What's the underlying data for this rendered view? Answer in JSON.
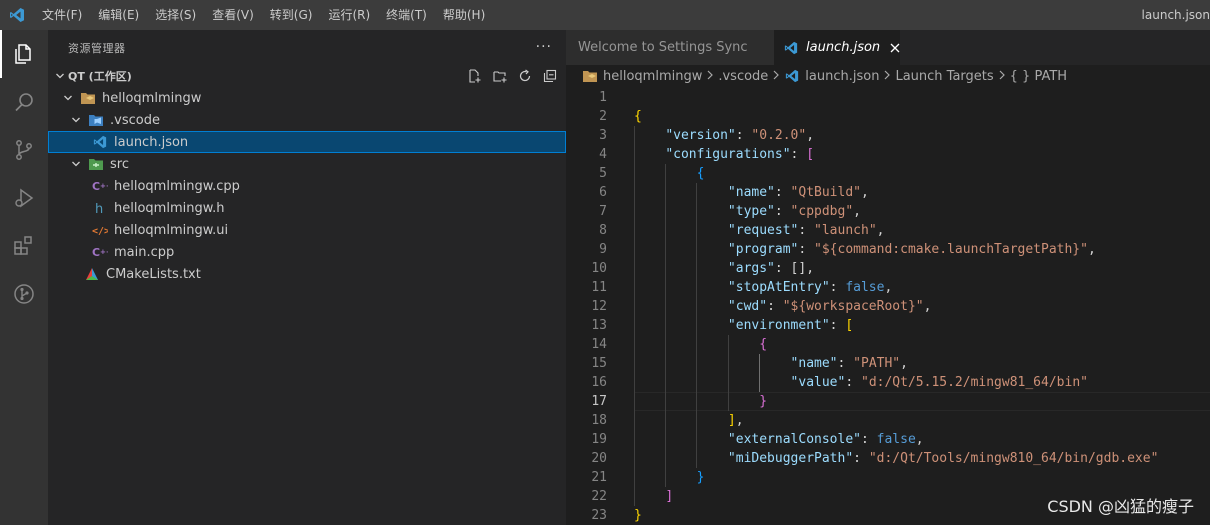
{
  "titlebar": {
    "menu": [
      "文件(F)",
      "编辑(E)",
      "选择(S)",
      "查看(V)",
      "转到(G)",
      "运行(R)",
      "终端(T)",
      "帮助(H)"
    ],
    "window_title": "launch.json"
  },
  "activitybar": {
    "items": [
      "explorer-icon",
      "search-icon",
      "source-control-icon",
      "run-debug-icon",
      "extensions-icon",
      "git-graph-icon"
    ]
  },
  "sidebar": {
    "title": "资源管理器",
    "more": "···",
    "workspace": "QT (工作区)",
    "tree": [
      {
        "label": "helloqmlmingw",
        "type": "folder",
        "indent": 1
      },
      {
        "label": ".vscode",
        "type": "vscode-folder",
        "indent": 2
      },
      {
        "label": "launch.json",
        "type": "json",
        "indent": 3,
        "selected": true
      },
      {
        "label": "src",
        "type": "src-folder",
        "indent": 2
      },
      {
        "label": "helloqmlmingw.cpp",
        "type": "cpp",
        "indent": 3
      },
      {
        "label": "helloqmlmingw.h",
        "type": "h",
        "indent": 3
      },
      {
        "label": "helloqmlmingw.ui",
        "type": "ui",
        "indent": 3
      },
      {
        "label": "main.cpp",
        "type": "cpp",
        "indent": 3
      },
      {
        "label": "CMakeLists.txt",
        "type": "cmake",
        "indent": 2
      }
    ]
  },
  "editor": {
    "tabs": [
      {
        "label": "Welcome to Settings Sync",
        "active": false
      },
      {
        "label": "launch.json",
        "active": true
      }
    ],
    "breadcrumbs": [
      "helloqmlmingw",
      ".vscode",
      "launch.json",
      "Launch Targets",
      "{ } PATH"
    ],
    "current_line": 17,
    "lines": [
      [],
      [
        [
          "br1",
          "{"
        ]
      ],
      [
        [
          "p",
          "    "
        ],
        [
          "k",
          "\"version\""
        ],
        [
          "p",
          ": "
        ],
        [
          "s",
          "\"0.2.0\""
        ],
        [
          "p",
          ","
        ]
      ],
      [
        [
          "p",
          "    "
        ],
        [
          "k",
          "\"configurations\""
        ],
        [
          "p",
          ": "
        ],
        [
          "br2",
          "["
        ]
      ],
      [
        [
          "p",
          "        "
        ],
        [
          "br3",
          "{"
        ]
      ],
      [
        [
          "p",
          "            "
        ],
        [
          "k",
          "\"name\""
        ],
        [
          "p",
          ": "
        ],
        [
          "s",
          "\"QtBuild\""
        ],
        [
          "p",
          ","
        ]
      ],
      [
        [
          "p",
          "            "
        ],
        [
          "k",
          "\"type\""
        ],
        [
          "p",
          ": "
        ],
        [
          "s",
          "\"cppdbg\""
        ],
        [
          "p",
          ","
        ]
      ],
      [
        [
          "p",
          "            "
        ],
        [
          "k",
          "\"request\""
        ],
        [
          "p",
          ": "
        ],
        [
          "s",
          "\"launch\""
        ],
        [
          "p",
          ","
        ]
      ],
      [
        [
          "p",
          "            "
        ],
        [
          "k",
          "\"program\""
        ],
        [
          "p",
          ": "
        ],
        [
          "s",
          "\"${command:cmake.launchTargetPath}\""
        ],
        [
          "p",
          ","
        ]
      ],
      [
        [
          "p",
          "            "
        ],
        [
          "k",
          "\"args\""
        ],
        [
          "p",
          ": [],"
        ]
      ],
      [
        [
          "p",
          "            "
        ],
        [
          "k",
          "\"stopAtEntry\""
        ],
        [
          "p",
          ": "
        ],
        [
          "b",
          "false"
        ],
        [
          "p",
          ","
        ]
      ],
      [
        [
          "p",
          "            "
        ],
        [
          "k",
          "\"cwd\""
        ],
        [
          "p",
          ": "
        ],
        [
          "s",
          "\"${workspaceRoot}\""
        ],
        [
          "p",
          ","
        ]
      ],
      [
        [
          "p",
          "            "
        ],
        [
          "k",
          "\"environment\""
        ],
        [
          "p",
          ": "
        ],
        [
          "br1",
          "["
        ]
      ],
      [
        [
          "p",
          "                "
        ],
        [
          "br2",
          "{"
        ]
      ],
      [
        [
          "p",
          "                    "
        ],
        [
          "k",
          "\"name\""
        ],
        [
          "p",
          ": "
        ],
        [
          "s",
          "\"PATH\""
        ],
        [
          "p",
          ","
        ]
      ],
      [
        [
          "p",
          "                    "
        ],
        [
          "k",
          "\"value\""
        ],
        [
          "p",
          ": "
        ],
        [
          "s",
          "\"d:/Qt/5.15.2/mingw81_64/bin\""
        ]
      ],
      [
        [
          "p",
          "                "
        ],
        [
          "br2",
          "}"
        ]
      ],
      [
        [
          "p",
          "            "
        ],
        [
          "br1",
          "]"
        ],
        [
          "p",
          ","
        ]
      ],
      [
        [
          "p",
          "            "
        ],
        [
          "k",
          "\"externalConsole\""
        ],
        [
          "p",
          ": "
        ],
        [
          "b",
          "false"
        ],
        [
          "p",
          ","
        ]
      ],
      [
        [
          "p",
          "            "
        ],
        [
          "k",
          "\"miDebuggerPath\""
        ],
        [
          "p",
          ": "
        ],
        [
          "s",
          "\"d:/Qt/Tools/mingw810_64/bin/gdb.exe\""
        ]
      ],
      [
        [
          "p",
          "        "
        ],
        [
          "br3",
          "}"
        ]
      ],
      [
        [
          "p",
          "    "
        ],
        [
          "br2",
          "]"
        ]
      ],
      [
        [
          "br1",
          "}"
        ]
      ]
    ]
  },
  "watermark": "CSDN @凶猛的瘦子",
  "colors": {
    "accent": "#007acc",
    "vscode_blue": "#3c99d4",
    "string": "#ce9178",
    "key": "#9cdcfe",
    "keyword": "#569cd6"
  }
}
